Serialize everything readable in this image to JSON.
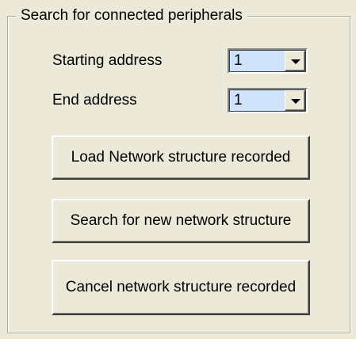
{
  "groupbox": {
    "legend": "Search for connected peripherals"
  },
  "starting_address": {
    "label": "Starting address",
    "value": "1"
  },
  "end_address": {
    "label": "End address",
    "value": "1"
  },
  "buttons": {
    "load": "Load Network structure recorded",
    "search": "Search for new network structure",
    "cancel": "Cancel network structure recorded"
  },
  "icons": {
    "dropdown": "chevron-down-icon"
  },
  "colors": {
    "dialog_background": "#ece9d8",
    "combo_background": "#cfe3fb",
    "frame_line": "#aca899"
  }
}
